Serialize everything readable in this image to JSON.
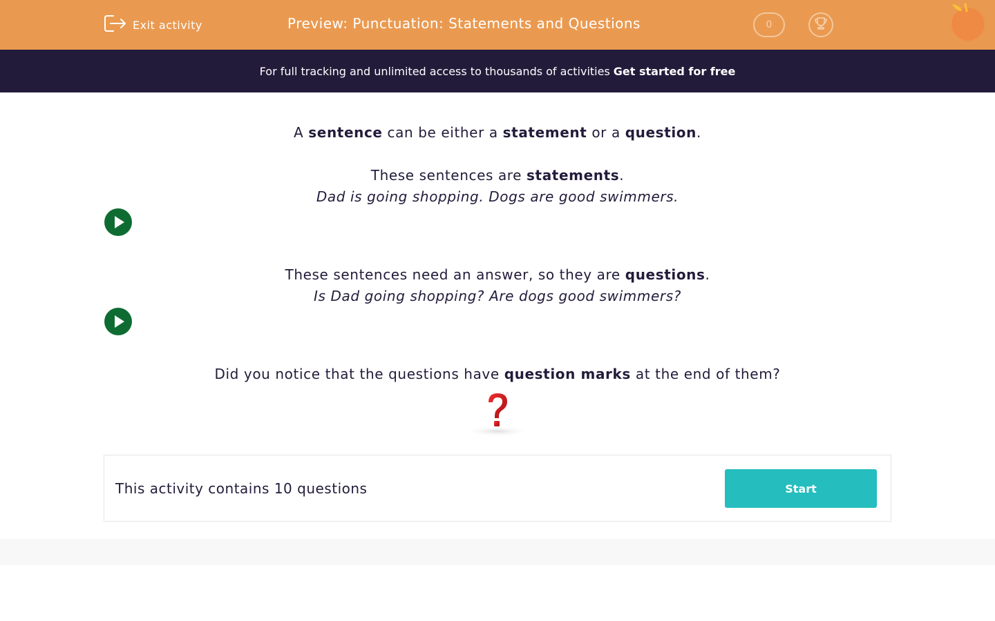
{
  "header": {
    "exit_label": "Exit activity",
    "title": "Preview: Punctuation: Statements and Questions",
    "score": "0",
    "background_color": "#ea9a50"
  },
  "promo": {
    "text": "For full tracking and unlimited access to thousands of activities",
    "link": "Get started for free"
  },
  "content": {
    "intro": {
      "p1": "A ",
      "b1": "sentence",
      "p2": " can be either a ",
      "b2": "statement",
      "p3": " or a ",
      "b3": "question",
      "p4": "."
    },
    "statements": {
      "p1": "These sentences are ",
      "b1": "statements",
      "p2": ".",
      "example": "Dad is going shopping.  Dogs are good swimmers."
    },
    "questions": {
      "p1": "These sentences need an answer, so they are ",
      "b1": "questions",
      "p2": ".",
      "example": "Is Dad going shopping?  Are dogs good swimmers?"
    },
    "notice": {
      "p1": "Did you notice that the questions have ",
      "b1": "question marks",
      "p2": " at the end of them?"
    }
  },
  "panel": {
    "text": "This activity contains 10 questions",
    "start_label": "Start",
    "start_color": "#25bdbd"
  },
  "icons": [
    "exit-icon",
    "trophy-icon",
    "logo-icon",
    "play-icon",
    "question-mark-image"
  ]
}
